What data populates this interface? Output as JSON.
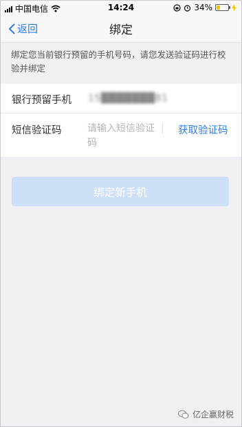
{
  "status_bar": {
    "carrier": "中国电信",
    "time": "14:24",
    "battery_percent": "34%",
    "battery_level": 0.34,
    "icons": [
      "signal-icon",
      "wifi-icon",
      "rotation-lock-icon",
      "alarm-icon",
      "battery-icon",
      "charging-icon"
    ]
  },
  "nav": {
    "back_label": "返回",
    "title": "绑定"
  },
  "notice": "绑定您当前银行预留的手机号码，请您发送验证码进行校验并绑定",
  "form": {
    "phone_label": "银行预留手机",
    "phone_value": "15███████81",
    "code_label": "短信验证码",
    "code_placeholder": "请输入短信验证码",
    "get_code_label": "获取验证码"
  },
  "bind_button_label": "绑定新手机",
  "watermark": "亿企赢财税",
  "colors": {
    "accent": "#2b7de9",
    "button_disabled": "#cde0f8",
    "background": "#eff0f4"
  }
}
